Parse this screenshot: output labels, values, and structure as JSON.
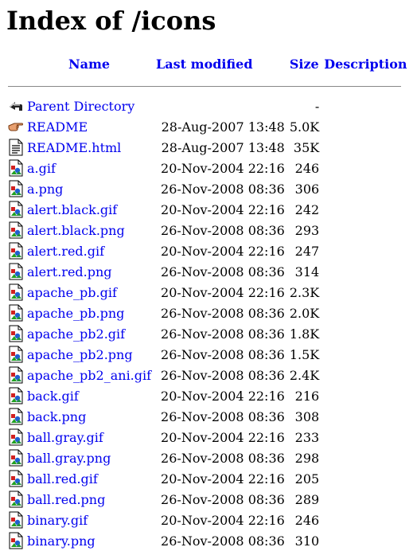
{
  "title": "Index of /icons",
  "columns": {
    "name": "Name",
    "last_modified": "Last modified",
    "size": "Size",
    "description": "Description"
  },
  "rows": [
    {
      "icon": "back-icon",
      "name": "Parent Directory",
      "date": "",
      "size": "-"
    },
    {
      "icon": "hand-icon",
      "name": "README",
      "date": "28-Aug-2007 13:48",
      "size": "5.0K"
    },
    {
      "icon": "text-file-icon",
      "name": "README.html",
      "date": "28-Aug-2007 13:48",
      "size": "35K"
    },
    {
      "icon": "image-icon",
      "name": "a.gif",
      "date": "20-Nov-2004 22:16",
      "size": "246"
    },
    {
      "icon": "image-icon",
      "name": "a.png",
      "date": "26-Nov-2008 08:36",
      "size": "306"
    },
    {
      "icon": "image-icon",
      "name": "alert.black.gif",
      "date": "20-Nov-2004 22:16",
      "size": "242"
    },
    {
      "icon": "image-icon",
      "name": "alert.black.png",
      "date": "26-Nov-2008 08:36",
      "size": "293"
    },
    {
      "icon": "image-icon",
      "name": "alert.red.gif",
      "date": "20-Nov-2004 22:16",
      "size": "247"
    },
    {
      "icon": "image-icon",
      "name": "alert.red.png",
      "date": "26-Nov-2008 08:36",
      "size": "314"
    },
    {
      "icon": "image-icon",
      "name": "apache_pb.gif",
      "date": "20-Nov-2004 22:16",
      "size": "2.3K"
    },
    {
      "icon": "image-icon",
      "name": "apache_pb.png",
      "date": "26-Nov-2008 08:36",
      "size": "2.0K"
    },
    {
      "icon": "image-icon",
      "name": "apache_pb2.gif",
      "date": "26-Nov-2008 08:36",
      "size": "1.8K"
    },
    {
      "icon": "image-icon",
      "name": "apache_pb2.png",
      "date": "26-Nov-2008 08:36",
      "size": "1.5K"
    },
    {
      "icon": "image-icon",
      "name": "apache_pb2_ani.gif",
      "date": "26-Nov-2008 08:36",
      "size": "2.4K"
    },
    {
      "icon": "image-icon",
      "name": "back.gif",
      "date": "20-Nov-2004 22:16",
      "size": "216"
    },
    {
      "icon": "image-icon",
      "name": "back.png",
      "date": "26-Nov-2008 08:36",
      "size": "308"
    },
    {
      "icon": "image-icon",
      "name": "ball.gray.gif",
      "date": "20-Nov-2004 22:16",
      "size": "233"
    },
    {
      "icon": "image-icon",
      "name": "ball.gray.png",
      "date": "26-Nov-2008 08:36",
      "size": "298"
    },
    {
      "icon": "image-icon",
      "name": "ball.red.gif",
      "date": "20-Nov-2004 22:16",
      "size": "205"
    },
    {
      "icon": "image-icon",
      "name": "ball.red.png",
      "date": "26-Nov-2008 08:36",
      "size": "289"
    },
    {
      "icon": "image-icon",
      "name": "binary.gif",
      "date": "20-Nov-2004 22:16",
      "size": "246"
    },
    {
      "icon": "image-icon",
      "name": "binary.png",
      "date": "26-Nov-2008 08:36",
      "size": "310"
    }
  ]
}
